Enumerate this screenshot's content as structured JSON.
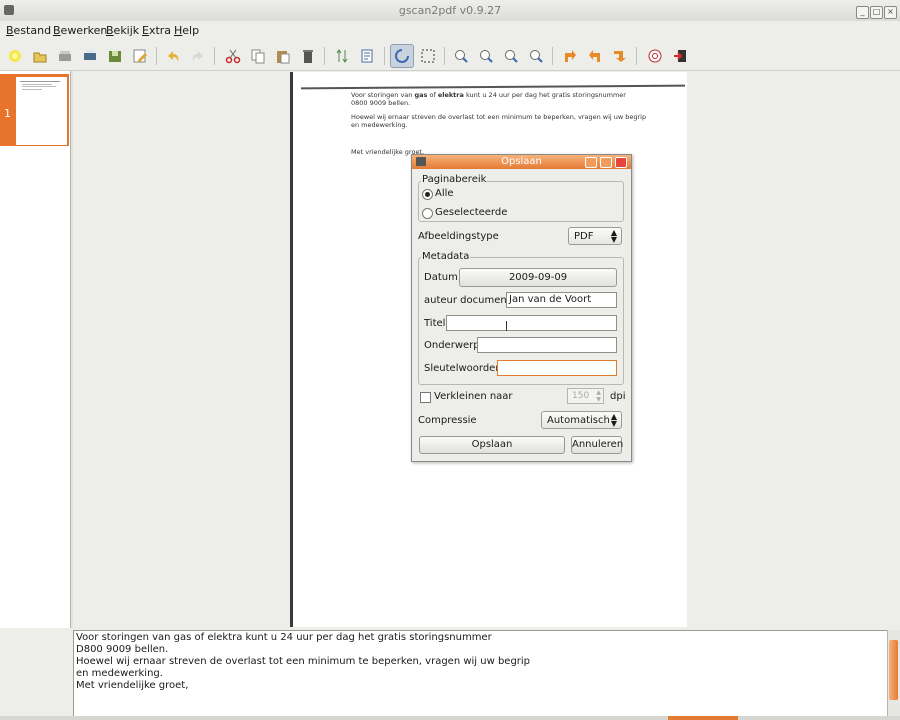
{
  "window": {
    "title": "gscan2pdf v0.9.27"
  },
  "menu": {
    "items": [
      {
        "key": "B",
        "rest": "estand"
      },
      {
        "key": "B",
        "rest": "ewerken"
      },
      {
        "key": "B",
        "rest": "ekijk"
      },
      {
        "key": "E",
        "rest": "xtra"
      },
      {
        "key": "H",
        "rest": "elp"
      }
    ]
  },
  "toolbar": {
    "icons": [
      "new-icon",
      "open-icon",
      "scan-icon",
      "print-icon",
      "save-icon",
      "edit-icon",
      "undo-icon",
      "redo-icon",
      "cut-icon",
      "copy-icon",
      "paste-icon",
      "delete-icon",
      "renumber-icon",
      "properties-icon",
      "select-icon",
      "select-region-icon",
      "zoom-100-icon",
      "zoom-fit-icon",
      "zoom-in-icon",
      "zoom-out-icon",
      "rotate-90-icon",
      "rotate-180-icon",
      "rotate-270-icon",
      "help-icon",
      "quit-icon"
    ]
  },
  "thumbnails": {
    "page_number": "1"
  },
  "page_text": {
    "line1_a": "Voor storingen van ",
    "line1_b": "gas",
    "line1_c": " of ",
    "line1_d": "elektra",
    "line1_e": " kunt u 24 uur per dag het gratis storingsnummer",
    "line2": "0800 9009 bellen.",
    "line3": "Hoewel wij ernaar streven de overlast tot een minimum te beperken, vragen wij uw begrip",
    "line4": "en medewerking.",
    "line5": "Met vriendelijke groet,"
  },
  "dialog": {
    "title": "Opslaan",
    "page_range": {
      "legend": "Paginabereik",
      "all_label": "Alle",
      "selected_label": "Geselecteerde",
      "selected": "Alle"
    },
    "image_type": {
      "label": "Afbeeldingstype",
      "value": "PDF"
    },
    "metadata": {
      "legend": "Metadata",
      "date_label": "Datum",
      "date_value": "2009-09-09",
      "author_label": "auteur document",
      "author_value": "Jan van de Voort",
      "title_label": "Titel",
      "title_value": "",
      "subject_label": "Onderwerp",
      "subject_value": "",
      "keywords_label": "Sleutelwoorden",
      "keywords_value": ""
    },
    "resize": {
      "label": "Verkleinen naar",
      "value": "150",
      "unit": "dpi",
      "checked": false
    },
    "compression": {
      "label": "Compressie",
      "value": "Automatisch"
    },
    "save_button": "Opslaan",
    "cancel_button": "Annuleren"
  },
  "ocr_text": {
    "lines": [
      "Voor storingen van gas of elektra kunt u 24 uur per dag het gratis storingsnummer",
      "D800 9009 bellen.",
      "Hoewel wij ernaar streven de overlast tot een minimum te beperken, vragen wij uw begrip",
      "en medewerking.",
      "Met vriendelijke groet,"
    ]
  },
  "colors": {
    "accent": "#e47b34",
    "dialog_title": "#f29c5c"
  }
}
